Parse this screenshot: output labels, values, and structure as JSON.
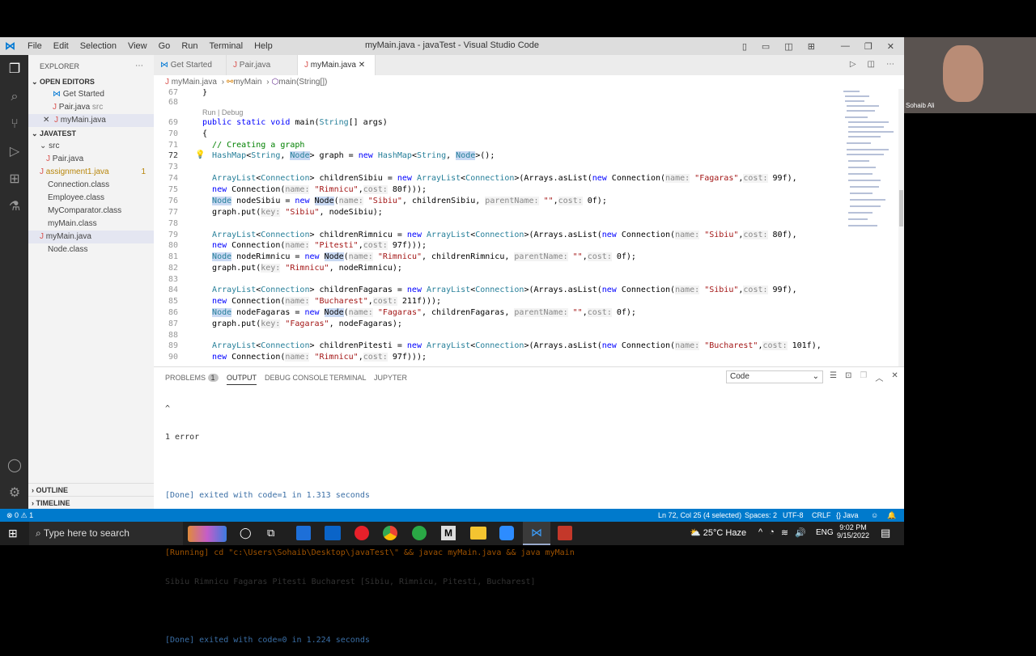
{
  "window": {
    "title": "myMain.java - javaTest - Visual Studio Code",
    "menu": [
      "File",
      "Edit",
      "Selection",
      "View",
      "Go",
      "Run",
      "Terminal",
      "Help"
    ]
  },
  "explorer": {
    "title": "EXPLORER",
    "open_editors_title": "OPEN EDITORS",
    "open_editors": [
      {
        "label": "Get Started",
        "extra": ""
      },
      {
        "label": "Pair.java",
        "extra": "src"
      },
      {
        "label": "myMain.java",
        "extra": ""
      }
    ],
    "project_title": "JAVATEST",
    "files": [
      {
        "label": "src",
        "badge": ""
      },
      {
        "label": "Pair.java",
        "badge": ""
      },
      {
        "label": "assignment1.java",
        "badge": "1"
      },
      {
        "label": "Connection.class",
        "badge": ""
      },
      {
        "label": "Employee.class",
        "badge": ""
      },
      {
        "label": "MyComparator.class",
        "badge": ""
      },
      {
        "label": "myMain.class",
        "badge": ""
      },
      {
        "label": "myMain.java",
        "badge": ""
      },
      {
        "label": "Node.class",
        "badge": ""
      }
    ],
    "outline_title": "OUTLINE",
    "timeline_title": "TIMELINE"
  },
  "tabs": [
    "Get Started",
    "Pair.java",
    "myMain.java"
  ],
  "breadcrumb": {
    "file": "myMain.java",
    "class": "myMain",
    "method": "main(String[])"
  },
  "codelens": "Run | Debug",
  "line_numbers": [
    "67",
    "68",
    "69",
    "70",
    "71",
    "72",
    "73",
    "74",
    "75",
    "76",
    "77",
    "78",
    "79",
    "80",
    "81",
    "82",
    "83",
    "84",
    "85",
    "86",
    "87",
    "88",
    "89",
    "90"
  ],
  "panel": {
    "tabs": [
      "PROBLEMS",
      "OUTPUT",
      "DEBUG CONSOLE",
      "TERMINAL",
      "JUPYTER"
    ],
    "problems_count": "1",
    "dropdown": "Code",
    "output": [
      "^",
      "1 error",
      "",
      "[Done] exited with code=1 in 1.313 seconds",
      "",
      "[Running] cd \"c:\\Users\\Sohaib\\Desktop\\javaTest\\\" && javac myMain.java && java myMain",
      "Sibiu Rimnicu Fagaras Pitesti Bucharest [Sibiu, Rimnicu, Pitesti, Bucharest]",
      "",
      "[Done] exited with code=0 in 1.224 seconds"
    ]
  },
  "status": {
    "errors": "0",
    "warnings": "1",
    "position": "Ln 72, Col 25 (4 selected)",
    "spaces": "Spaces: 2",
    "encoding": "UTF-8",
    "eol": "CRLF",
    "language": "Java"
  },
  "taskbar": {
    "search_placeholder": "Type here to search",
    "weather": "25°C  Haze",
    "lang": "ENG",
    "time": "9:02 PM",
    "date": "9/15/2022"
  },
  "webcam": {
    "name": "Sohaib Ali"
  },
  "colors": {
    "statusbar": "#007acc",
    "activity": "#2c2c2c",
    "sidebar": "#f3f3f3"
  }
}
